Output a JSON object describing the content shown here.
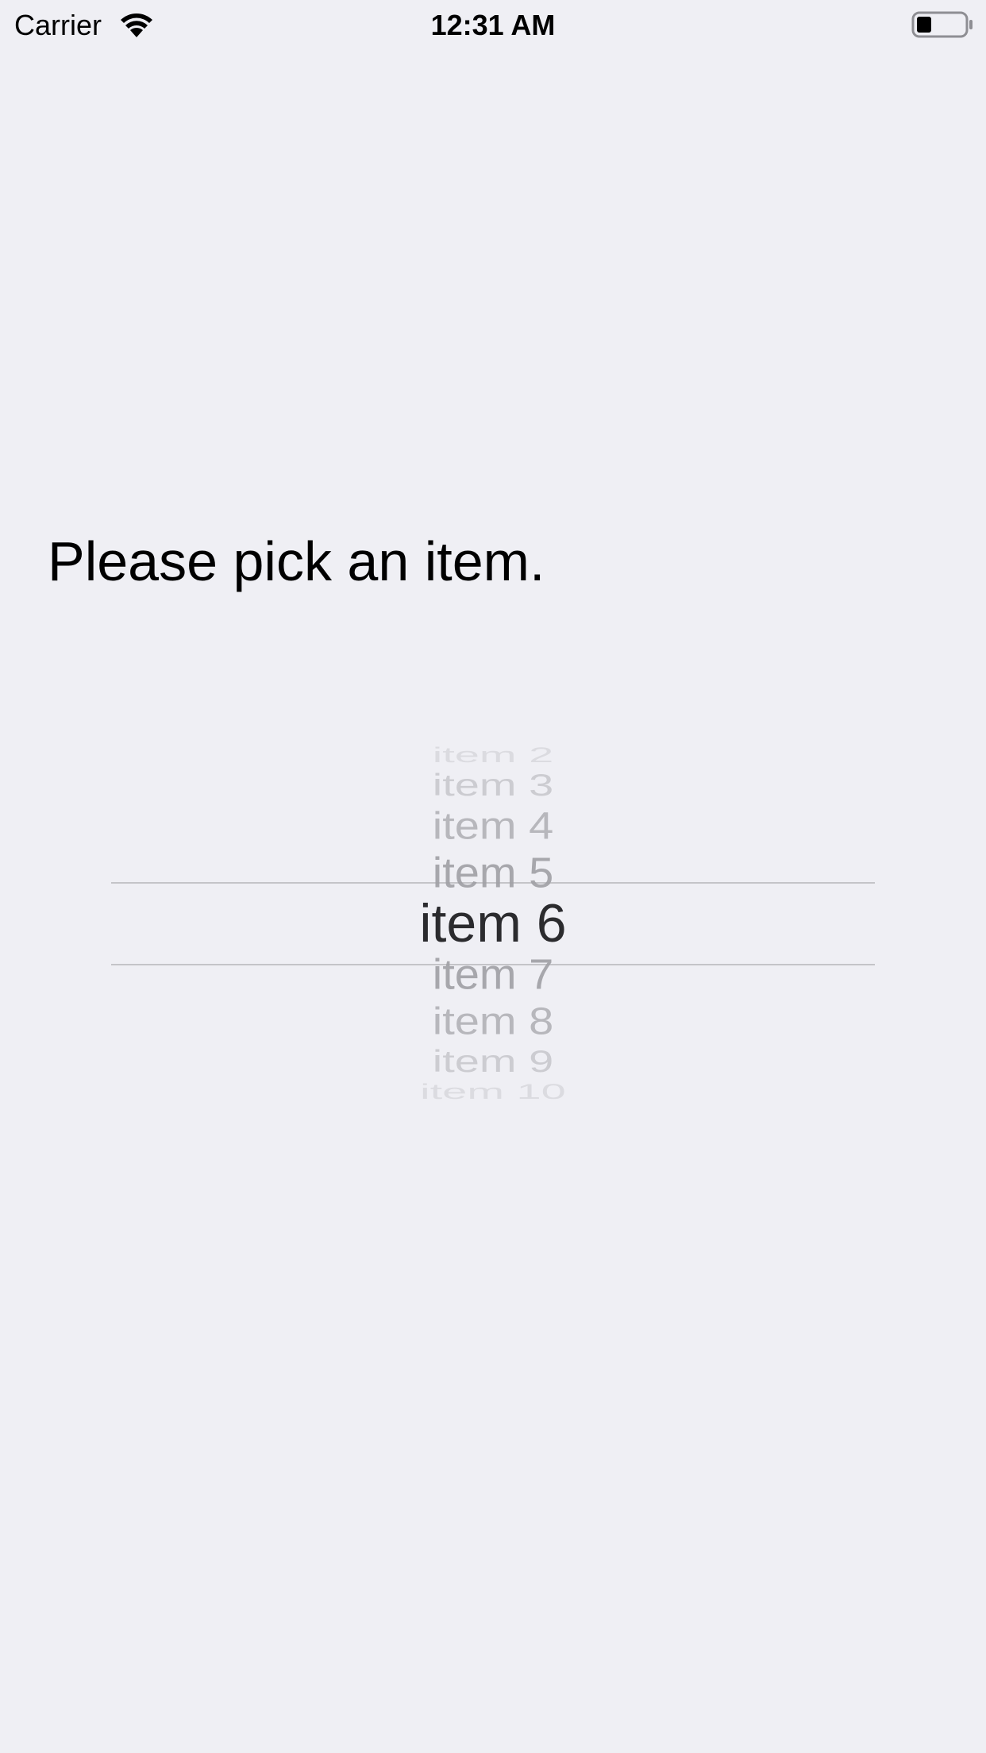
{
  "status_bar": {
    "carrier": "Carrier",
    "time": "12:31 AM",
    "wifi_icon": "wifi-icon",
    "battery_icon": "battery-icon"
  },
  "prompt": {
    "text": "Please pick an item."
  },
  "picker": {
    "selected": "item 6",
    "items": [
      "item 2",
      "item 3",
      "item 4",
      "item 5",
      "item 6",
      "item 7",
      "item 8",
      "item 9",
      "item 10"
    ]
  },
  "colors": {
    "background": "#efeff4",
    "selected_text": "#2b2b2e",
    "unselected_text": "#a1a1a6",
    "separator": "#c4c4c8"
  }
}
